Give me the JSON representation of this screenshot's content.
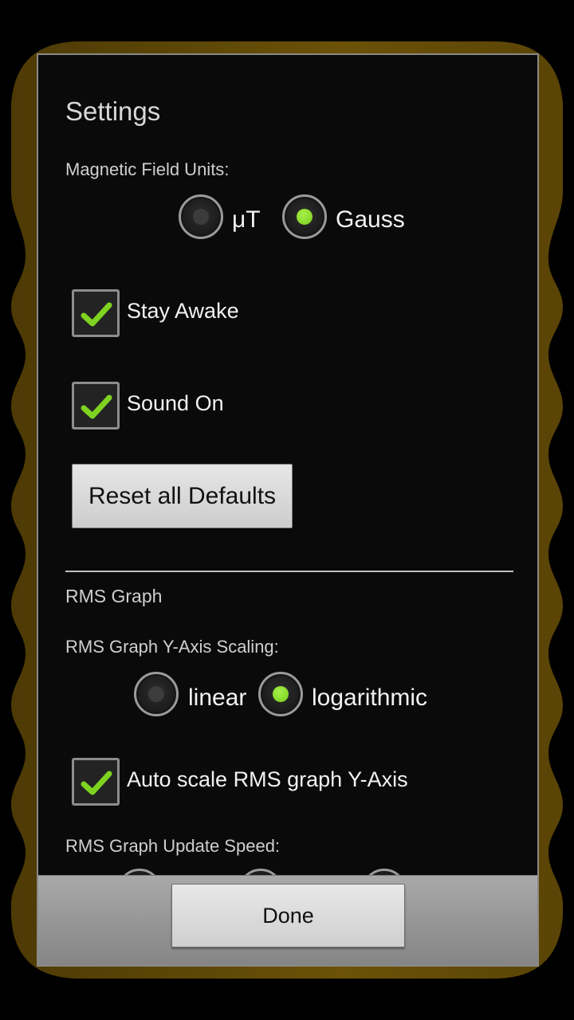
{
  "dialog": {
    "title": "Settings",
    "units": {
      "label": "Magnetic Field Units:",
      "options": [
        {
          "label": "μT",
          "selected": false
        },
        {
          "label": "Gauss",
          "selected": true
        }
      ]
    },
    "stay_awake": {
      "label": "Stay Awake",
      "checked": true
    },
    "sound_on": {
      "label": "Sound On",
      "checked": true
    },
    "reset_button": "Reset all Defaults",
    "rms_section": {
      "header": "RMS Graph",
      "y_axis_scaling": {
        "label": "RMS Graph Y-Axis Scaling:",
        "options": [
          {
            "label": "linear",
            "selected": false
          },
          {
            "label": "logarithmic",
            "selected": true
          }
        ]
      },
      "auto_scale": {
        "label": "Auto scale RMS graph Y-Axis",
        "checked": true
      },
      "update_speed": {
        "label": "RMS Graph Update Speed:"
      }
    },
    "done_button": "Done"
  },
  "colors": {
    "accent_green": "#7ed321",
    "frame_gold": "#6b5208"
  }
}
